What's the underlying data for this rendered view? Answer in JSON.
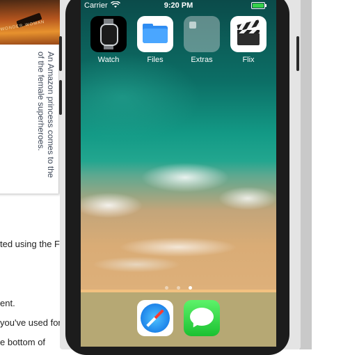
{
  "background_document": {
    "rotated_caption": [
      "An Amazon princess comes to the",
      "of the female superheroes."
    ],
    "lines": [
      {
        "text": "ted using the F"
      },
      {
        "text": "ent."
      },
      {
        "text": "you've used for"
      },
      {
        "text": "e bottom of"
      }
    ]
  },
  "simulator": {
    "status_bar": {
      "carrier": "Carrier",
      "time": "9:20 PM",
      "wifi_icon": "wifi-icon",
      "battery_icon": "battery-icon"
    },
    "apps": [
      {
        "label": "Watch",
        "icon": "watch-icon"
      },
      {
        "label": "Files",
        "icon": "folder-icon"
      },
      {
        "label": "Extras",
        "icon": "folder-group-icon"
      },
      {
        "label": "Flix",
        "icon": "clapperboard-icon"
      }
    ],
    "page_indicator": {
      "pages": 3,
      "current": 3
    },
    "dock": [
      {
        "app": "Safari",
        "icon": "compass-icon"
      },
      {
        "app": "Messages",
        "icon": "speech-bubble-icon"
      }
    ],
    "colors": {
      "battery": "#37d04a",
      "dock": "#fac882"
    }
  }
}
